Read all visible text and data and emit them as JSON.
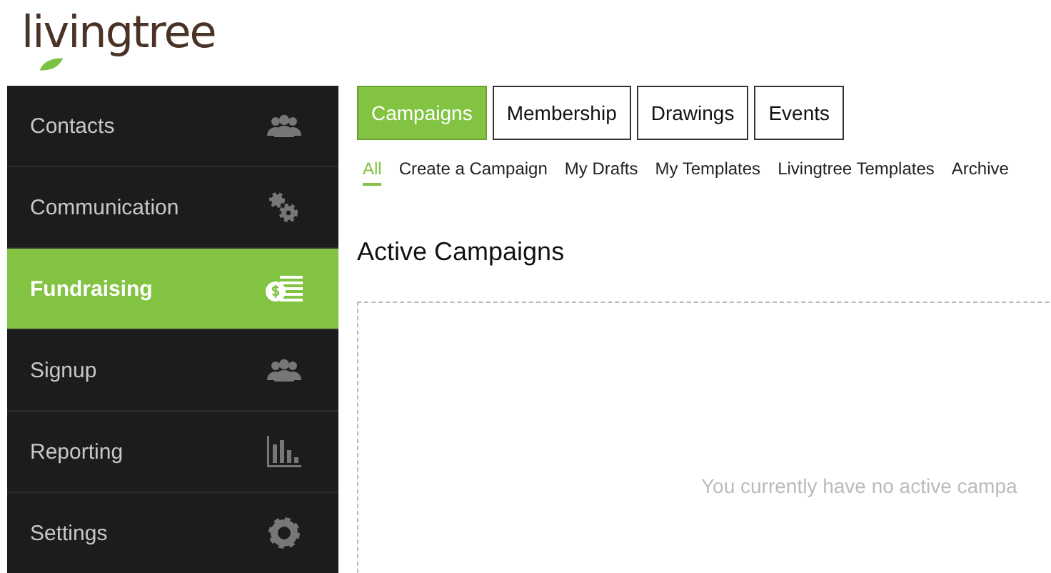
{
  "logo": {
    "text": "livingtree"
  },
  "sidebar": {
    "items": [
      {
        "label": "Contacts",
        "selected": false
      },
      {
        "label": "Communication",
        "selected": false
      },
      {
        "label": "Fundraising",
        "selected": true
      },
      {
        "label": "Signup",
        "selected": false
      },
      {
        "label": "Reporting",
        "selected": false
      },
      {
        "label": "Settings",
        "selected": false
      }
    ]
  },
  "tabs": [
    {
      "label": "Campaigns",
      "selected": true
    },
    {
      "label": "Membership",
      "selected": false
    },
    {
      "label": "Drawings",
      "selected": false
    },
    {
      "label": "Events",
      "selected": false
    }
  ],
  "subnav": [
    {
      "label": "All",
      "selected": true
    },
    {
      "label": "Create a Campaign",
      "selected": false
    },
    {
      "label": "My Drafts",
      "selected": false
    },
    {
      "label": "My Templates",
      "selected": false
    },
    {
      "label": "Livingtree Templates",
      "selected": false
    },
    {
      "label": "Archive",
      "selected": false
    }
  ],
  "section": {
    "title": "Active Campaigns",
    "empty_message": "You currently have no active campa"
  }
}
